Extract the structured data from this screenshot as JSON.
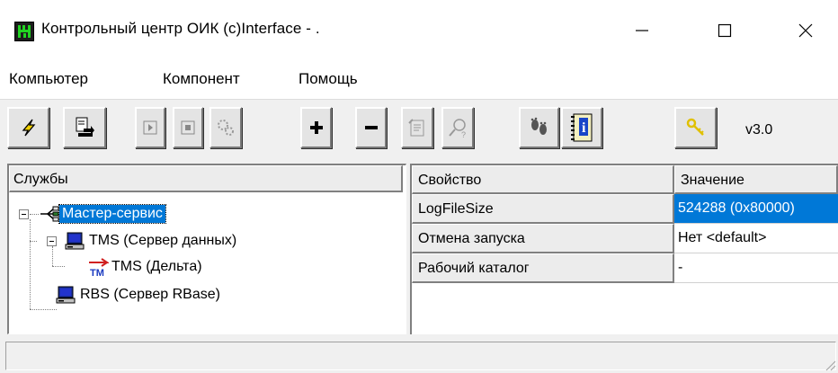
{
  "window": {
    "title": "Контрольный центр ОИК (c)Interface - .",
    "controls": [
      "minimize-icon",
      "maximize-icon",
      "close-icon"
    ]
  },
  "menu": {
    "items": [
      "Компьютер",
      "Компонент",
      "Помощь"
    ]
  },
  "toolbar": {
    "buttons": [
      {
        "name": "connect-button",
        "icon": "lightning-icon"
      },
      {
        "name": "import-button",
        "icon": "import-document-icon"
      },
      {
        "name": "start-button",
        "icon": "play-icon"
      },
      {
        "name": "stop-button",
        "icon": "stop-icon"
      },
      {
        "name": "restart-button",
        "icon": "gears-icon"
      },
      {
        "name": "add-button",
        "icon": "plus-icon"
      },
      {
        "name": "remove-button",
        "icon": "minus-icon"
      },
      {
        "name": "properties-button",
        "icon": "properties-icon"
      },
      {
        "name": "find-button",
        "icon": "search-help-icon"
      },
      {
        "name": "users-button",
        "icon": "footprints-icon"
      },
      {
        "name": "info-button",
        "icon": "info-book-icon"
      },
      {
        "name": "key-button",
        "icon": "key-icon"
      }
    ],
    "version": "v3.0"
  },
  "tree": {
    "header": "Службы",
    "nodes": [
      {
        "label": "Мастер-сервис",
        "icon": "network-hub-icon",
        "selected": true
      },
      {
        "label": "TMS (Сервер данных)",
        "icon": "computer-icon"
      },
      {
        "label": "TMS (Дельта)",
        "icon": "tm-delta-icon"
      },
      {
        "label": "RBS (Сервер RBase)",
        "icon": "computer-icon"
      }
    ]
  },
  "properties": {
    "headers": [
      "Свойство",
      "Значение"
    ],
    "rows": [
      {
        "name": "LogFileSize",
        "value": "524288 (0x80000)",
        "selected": true
      },
      {
        "name": "Отмена запуска",
        "value": "Нет <default>"
      },
      {
        "name": "Рабочий каталог",
        "value": "-"
      }
    ]
  },
  "colors": {
    "selection": "#0078d7",
    "app_icon_bg": "#1d1d1d",
    "app_icon_fg": "#22d422"
  }
}
